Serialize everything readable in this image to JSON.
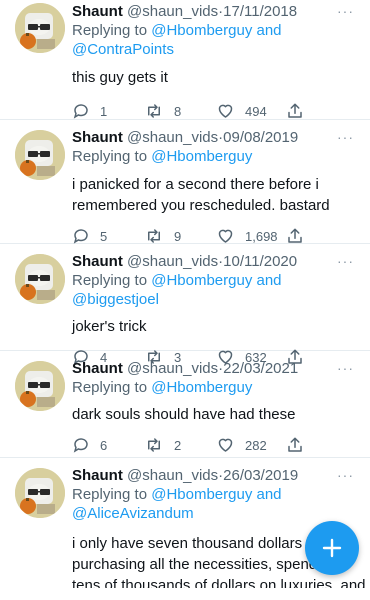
{
  "colors": {
    "accent": "#1d9bf0",
    "muted": "#536471",
    "divider": "#e6ecf0"
  },
  "tweets": [
    {
      "name": "Shaunt",
      "handle": "@shaun_vids",
      "dot": "·",
      "date": "17/11/2018",
      "reply_prefix": "Replying to",
      "reply_to_line1": "@Hbomberguy and",
      "reply_to_line2": "@ContraPoints",
      "text": "this guy gets it",
      "replies": "1",
      "retweets": "8",
      "likes": "494"
    },
    {
      "name": "Shaunt",
      "handle": "@shaun_vids",
      "dot": "·",
      "date": "09/08/2019",
      "reply_prefix": "Replying to",
      "reply_to_line1": "@Hbomberguy",
      "text_line1": "i panicked for a second there before i",
      "text_line2": "remembered you rescheduled. bastard",
      "replies": "5",
      "retweets": "9",
      "likes": "1,698"
    },
    {
      "name": "Shaunt",
      "handle": "@shaun_vids",
      "dot": "·",
      "date": "10/11/2020",
      "reply_prefix": "Replying to",
      "reply_to_line1": "@Hbomberguy and @biggestjoel",
      "text": "joker's trick",
      "replies": "4",
      "retweets": "3",
      "likes": "632"
    },
    {
      "name": "Shaunt",
      "handle": "@shaun_vids",
      "dot": "·",
      "date": "22/03/2021",
      "reply_prefix": "Replying to",
      "reply_to_line1": "@Hbomberguy",
      "text": "dark souls should have had these",
      "replies": "6",
      "retweets": "2",
      "likes": "282"
    },
    {
      "name": "Shaunt",
      "handle": "@shaun_vids",
      "dot": "·",
      "date": "26/03/2019",
      "reply_prefix": "Replying to",
      "reply_to_line1": "@Hbomberguy and",
      "reply_to_line2": "@AliceAvizandum",
      "text_line1": "i only have seven thousand dollars lef",
      "text_line2": "purchasing all the necessities, spendi",
      "text_line3": "tens of thousands of dollars on luxuries, and"
    }
  ],
  "more_label": "···",
  "compose_label": "+"
}
